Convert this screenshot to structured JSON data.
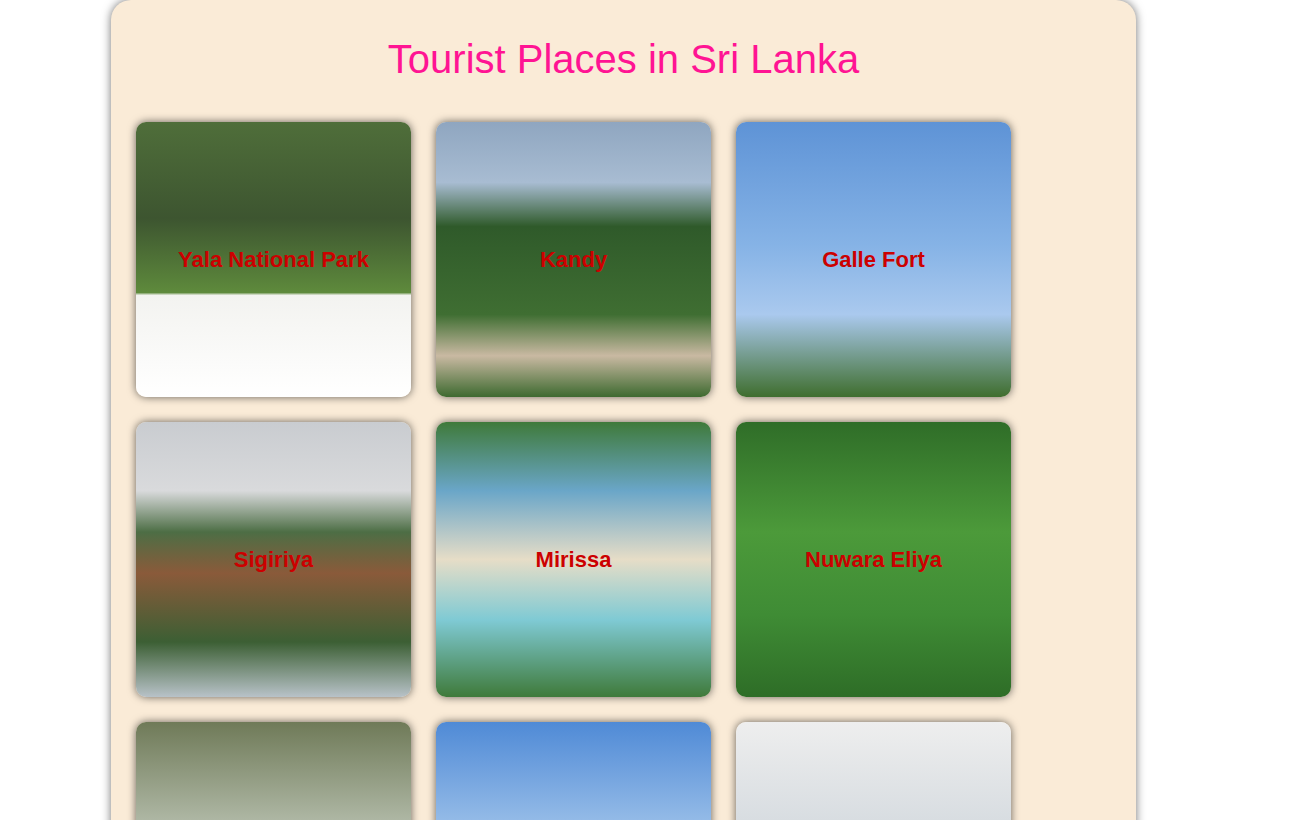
{
  "page": {
    "title": "Tourist Places in Sri Lanka"
  },
  "places": [
    {
      "name": "Yala National Park"
    },
    {
      "name": "Kandy"
    },
    {
      "name": "Galle Fort"
    },
    {
      "name": "Sigiriya"
    },
    {
      "name": "Mirissa"
    },
    {
      "name": "Nuwara Eliya"
    },
    {},
    {},
    {}
  ]
}
